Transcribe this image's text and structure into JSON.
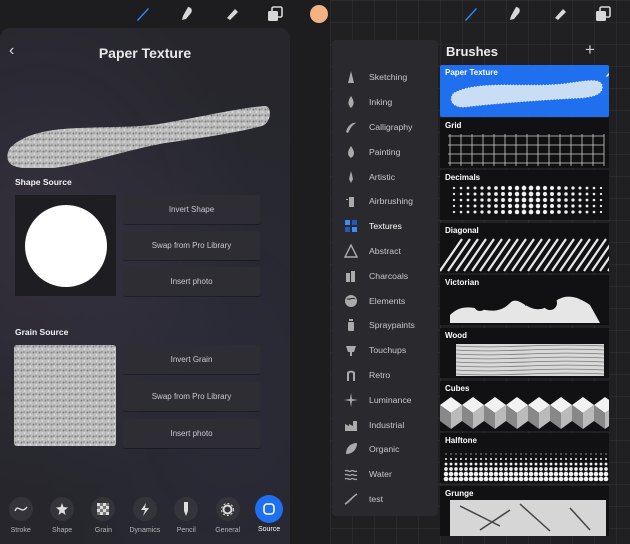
{
  "left_screen": {
    "title": "Paper Texture",
    "back_icon": "chevron-left-icon",
    "shape_source_label": "Shape Source",
    "shape_buttons": [
      "Invert Shape",
      "Swap from Pro Library",
      "Insert photo"
    ],
    "grain_source_label": "Grain Source",
    "grain_buttons": [
      "Invert Grain",
      "Swap from Pro Library",
      "Insert photo"
    ],
    "tabs": [
      {
        "label": "Stroke",
        "icon": "stroke-icon"
      },
      {
        "label": "Shape",
        "icon": "shape-icon"
      },
      {
        "label": "Grain",
        "icon": "grain-icon"
      },
      {
        "label": "Dynamics",
        "icon": "dynamics-icon"
      },
      {
        "label": "Pencil",
        "icon": "pencil-icon"
      },
      {
        "label": "General",
        "icon": "general-icon"
      },
      {
        "label": "Source",
        "icon": "source-icon",
        "active": true
      }
    ],
    "color_swatch": "#f4b183"
  },
  "right_screen": {
    "header": "Brushes",
    "add_icon": "plus-icon",
    "categories": [
      {
        "label": "Sketching",
        "icon": "sketching-icon"
      },
      {
        "label": "Inking",
        "icon": "inking-icon"
      },
      {
        "label": "Calligraphy",
        "icon": "calligraphy-icon"
      },
      {
        "label": "Painting",
        "icon": "painting-icon"
      },
      {
        "label": "Artistic",
        "icon": "artistic-icon"
      },
      {
        "label": "Airbrushing",
        "icon": "airbrushing-icon"
      },
      {
        "label": "Textures",
        "icon": "textures-icon",
        "active": true
      },
      {
        "label": "Abstract",
        "icon": "abstract-icon"
      },
      {
        "label": "Charcoals",
        "icon": "charcoals-icon"
      },
      {
        "label": "Elements",
        "icon": "elements-icon"
      },
      {
        "label": "Spraypaints",
        "icon": "spraypaints-icon"
      },
      {
        "label": "Touchups",
        "icon": "touchups-icon"
      },
      {
        "label": "Retro",
        "icon": "retro-icon"
      },
      {
        "label": "Luminance",
        "icon": "luminance-icon"
      },
      {
        "label": "Industrial",
        "icon": "industrial-icon"
      },
      {
        "label": "Organic",
        "icon": "organic-icon"
      },
      {
        "label": "Water",
        "icon": "water-icon"
      },
      {
        "label": "test",
        "icon": "test-icon"
      }
    ],
    "brushes": [
      {
        "label": "Paper Texture",
        "selected": true
      },
      {
        "label": "Grid"
      },
      {
        "label": "Decimals"
      },
      {
        "label": "Diagonal"
      },
      {
        "label": "Victorian"
      },
      {
        "label": "Wood"
      },
      {
        "label": "Cubes"
      },
      {
        "label": "Halftone"
      },
      {
        "label": "Grunge"
      }
    ]
  },
  "colors": {
    "accent": "#1e6ff1",
    "panel": "#26262c"
  }
}
